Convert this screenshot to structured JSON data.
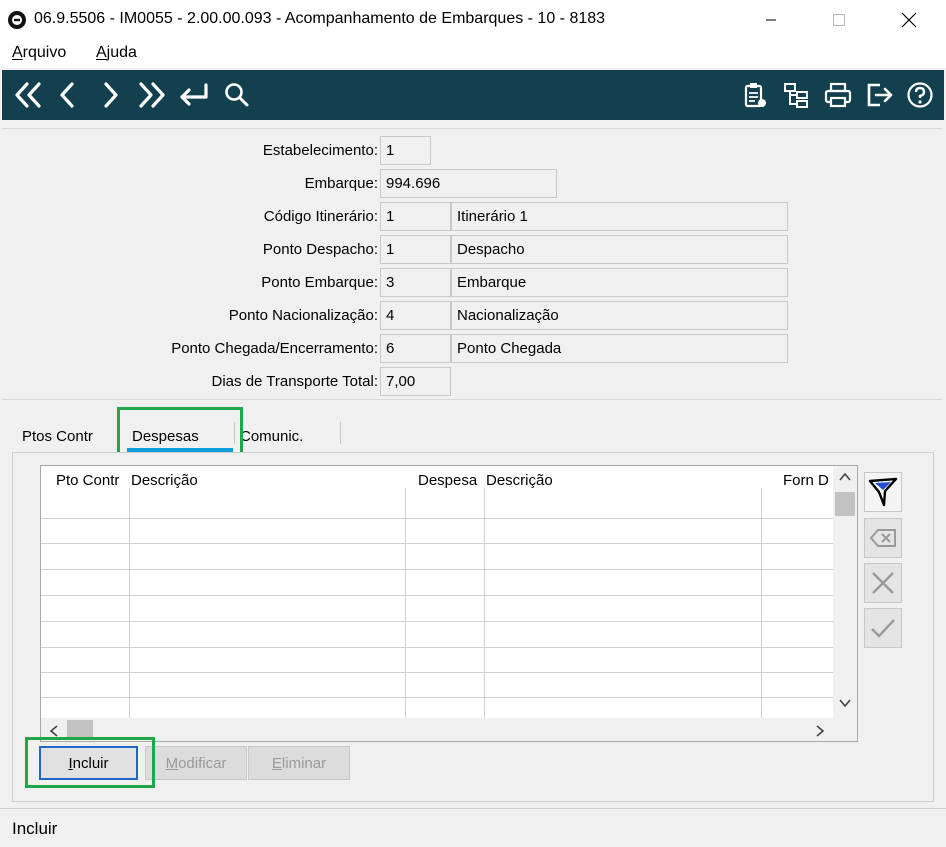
{
  "window": {
    "title": "06.9.5506 - IM0055 - 2.00.00.093 - Acompanhamento de Embarques - 10 - 8183"
  },
  "menu": {
    "arquivo_prefix": "A",
    "arquivo_rest": "rquivo",
    "ajuda_prefix": "A",
    "ajuda_rest": "juda"
  },
  "toolbar": {
    "accent": "#12404f",
    "icons": [
      "first-icon",
      "previous-icon",
      "next-icon",
      "last-icon",
      "goto-icon",
      "search-icon",
      "report-icon",
      "tree-icon",
      "print-icon",
      "exit-icon",
      "help-icon"
    ]
  },
  "form": {
    "estabelecimento_label": "Estabelecimento:",
    "estabelecimento_value": "1",
    "embarque_label": "Embarque:",
    "embarque_value": "994.696",
    "codigo_itinerario_label": "Código Itinerário:",
    "codigo_itinerario_code": "1",
    "codigo_itinerario_desc": "Itinerário 1",
    "ponto_despacho_label": "Ponto Despacho:",
    "ponto_despacho_code": "1",
    "ponto_despacho_desc": "Despacho",
    "ponto_embarque_label": "Ponto Embarque:",
    "ponto_embarque_code": "3",
    "ponto_embarque_desc": "Embarque",
    "ponto_nacionalizacao_label": "Ponto Nacionalização:",
    "ponto_nacionalizacao_code": "4",
    "ponto_nacionalizacao_desc": "Nacionalização",
    "ponto_chegada_label": "Ponto Chegada/Encerramento:",
    "ponto_chegada_code": "6",
    "ponto_chegada_desc": "Ponto Chegada",
    "dias_transporte_label": "Dias de Transporte Total:",
    "dias_transporte_value": "7,00"
  },
  "tabs": {
    "pontos": "Ptos Contr",
    "despesas": "Despesas",
    "comunic": "Comunic.",
    "active_color": "#0b9ed8"
  },
  "grid": {
    "columns": [
      "Pto Contr",
      "Descrição",
      "Despesa",
      "Descrição",
      "Forn D"
    ]
  },
  "buttons": {
    "incluir_prefix": "I",
    "incluir_rest": "ncluir",
    "modificar_prefix": "M",
    "modificar_rest": "odificar",
    "eliminar_prefix": "E",
    "eliminar_rest": "liminar"
  },
  "highlight_color": "#1fa74a",
  "status": {
    "text": "Incluir"
  }
}
